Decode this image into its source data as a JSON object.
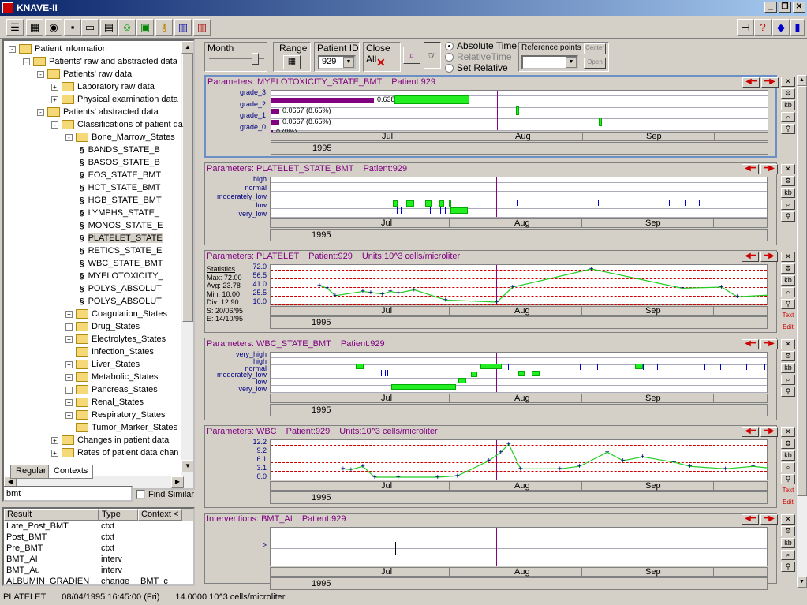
{
  "app": {
    "title": "KNAVE-II"
  },
  "toolbar_icons": [
    "tree-icon",
    "table-icon",
    "camera-icon",
    "save-icon",
    "open-folder-icon",
    "print-icon",
    "run-icon",
    "monitor-icon",
    "key-icon",
    "bar-chart-icon",
    "books-icon"
  ],
  "tree": {
    "items": [
      {
        "label": "Patient information",
        "level": 0,
        "exp": "-",
        "folder": true
      },
      {
        "label": "Patients' raw and abstracted data",
        "level": 1,
        "exp": "-",
        "folder": true
      },
      {
        "label": "Patients' raw data",
        "level": 2,
        "exp": "-",
        "folder": true
      },
      {
        "label": "Laboratory raw data",
        "level": 3,
        "exp": "+",
        "folder": true
      },
      {
        "label": "Physical examination data",
        "level": 3,
        "exp": "+",
        "folder": true
      },
      {
        "label": "Patients' abstracted data",
        "level": 2,
        "exp": "-",
        "folder": true
      },
      {
        "label": "Classifications of patient da",
        "level": 3,
        "exp": "-",
        "folder": true
      },
      {
        "label": "Bone_Marrow_States",
        "level": 4,
        "exp": "-",
        "folder": true
      },
      {
        "label": "BANDS_STATE_B",
        "level": 5,
        "leaf": true
      },
      {
        "label": "BASOS_STATE_B",
        "level": 5,
        "leaf": true
      },
      {
        "label": "EOS_STATE_BMT",
        "level": 5,
        "leaf": true
      },
      {
        "label": "HCT_STATE_BMT",
        "level": 5,
        "leaf": true
      },
      {
        "label": "HGB_STATE_BMT",
        "level": 5,
        "leaf": true
      },
      {
        "label": "LYMPHS_STATE_",
        "level": 5,
        "leaf": true
      },
      {
        "label": "MONOS_STATE_E",
        "level": 5,
        "leaf": true
      },
      {
        "label": "PLATELET_STATE",
        "level": 5,
        "leaf": true,
        "selected": true
      },
      {
        "label": "RETICS_STATE_E",
        "level": 5,
        "leaf": true
      },
      {
        "label": "WBC_STATE_BMT",
        "level": 5,
        "leaf": true
      },
      {
        "label": "MYELOTOXICITY_",
        "level": 5,
        "leaf": true
      },
      {
        "label": "POLYS_ABSOLUT",
        "level": 5,
        "leaf": true
      },
      {
        "label": "POLYS_ABSOLUT",
        "level": 5,
        "leaf": true
      },
      {
        "label": "Coagulation_States",
        "level": 4,
        "exp": "+",
        "folder": true
      },
      {
        "label": "Drug_States",
        "level": 4,
        "exp": "+",
        "folder": true
      },
      {
        "label": "Electrolytes_States",
        "level": 4,
        "exp": "+",
        "folder": true
      },
      {
        "label": "Infection_States",
        "level": 4,
        "folder": true
      },
      {
        "label": "Liver_States",
        "level": 4,
        "exp": "+",
        "folder": true
      },
      {
        "label": "Metabolic_States",
        "level": 4,
        "exp": "+",
        "folder": true
      },
      {
        "label": "Pancreas_States",
        "level": 4,
        "exp": "+",
        "folder": true
      },
      {
        "label": "Renal_States",
        "level": 4,
        "exp": "+",
        "folder": true
      },
      {
        "label": "Respiratory_States",
        "level": 4,
        "exp": "+",
        "folder": true
      },
      {
        "label": "Tumor_Marker_States",
        "level": 4,
        "folder": true
      },
      {
        "label": "Changes in patient data",
        "level": 3,
        "exp": "+",
        "folder": true
      },
      {
        "label": "Rates of patient data chan",
        "level": 3,
        "exp": "+",
        "folder": true
      }
    ]
  },
  "tabs": {
    "regular": "Regular",
    "contexts": "Contexts"
  },
  "search": {
    "value": "bmt",
    "find_similar": "Find Similar"
  },
  "results": {
    "headers": [
      "Result",
      "Type",
      "Context <"
    ],
    "rows": [
      [
        "Late_Post_BMT",
        "ctxt",
        ""
      ],
      [
        "Post_BMT",
        "ctxt",
        ""
      ],
      [
        "Pre_BMT",
        "ctxt",
        ""
      ],
      [
        "BMT_AI",
        "interv",
        ""
      ],
      [
        "BMT_Au",
        "interv",
        ""
      ],
      [
        "ALBUMIN_GRADIEN",
        "change",
        "BMT_c"
      ]
    ]
  },
  "status": {
    "param": "PLATELET",
    "datetime": "08/04/1995 16:45:00 (Fri)",
    "value": "14.0000 10^3 cells/microliter"
  },
  "controls": {
    "month": "Month",
    "range": "Range",
    "patient_id_label": "Patient ID",
    "patient_id": "929",
    "close_all": "Close All",
    "absolute": "Absolute Time",
    "relative": "RelativeTime",
    "set_relative": "Set Relative",
    "ref_points": "Reference points",
    "center": "Center",
    "open": "Open"
  },
  "panels": [
    {
      "title": "Parameters: MYELOTOXICITY_STATE_BMT",
      "patient": "Patient:929",
      "units": "",
      "ylabels": [
        "grade_3",
        "grade_2",
        "grade_1",
        "grade_0"
      ],
      "dist": [
        "0.638 (82.7%)",
        "0.0667 (8.65%)",
        "0.0667 (8.65%)",
        "0 (0%)"
      ],
      "months": [
        "Jul",
        "Aug",
        "Sep"
      ],
      "year": "1995"
    },
    {
      "title": "Parameters: PLATELET_STATE_BMT",
      "patient": "Patient:929",
      "units": "",
      "ylabels": [
        "high",
        "normal",
        "moderately_low",
        "low",
        "very_low"
      ],
      "months": [
        "Jul",
        "Aug",
        "Sep"
      ],
      "year": "1995"
    },
    {
      "title": "Parameters: PLATELET",
      "patient": "Patient:929",
      "units": "Units:10^3 cells/microliter",
      "ylabels": [
        "72.0",
        "56.5",
        "41.0",
        "25.5",
        "10.0"
      ],
      "months": [
        "Jul",
        "Aug",
        "Sep"
      ],
      "year": "1995",
      "stats": [
        "Statistics",
        "Max: 72.00",
        "Avg: 23.78",
        "Min: 10.00",
        "Div: 12.90",
        "S: 20/06/95",
        "E: 14/10/95"
      ]
    },
    {
      "title": "Parameters: WBC_STATE_BMT",
      "patient": "Patient:929",
      "units": "",
      "ylabels": [
        "very_high",
        "high",
        "normal",
        "moderately_low",
        "low",
        "very_low"
      ],
      "months": [
        "Jul",
        "Aug",
        "Sep"
      ],
      "year": "1995"
    },
    {
      "title": "Parameters: WBC",
      "patient": "Patient:929",
      "units": "Units:10^3 cells/microliter",
      "ylabels": [
        "12.2",
        "9.2",
        "6.1",
        "3.1",
        "0.0"
      ],
      "months": [
        "Jul",
        "Aug",
        "Sep"
      ],
      "year": "1995"
    },
    {
      "title": "Interventions: BMT_AI",
      "patient": "Patient:929",
      "units": "",
      "ylabels": [
        ">"
      ],
      "months": [
        "Jul",
        "Aug",
        "Sep"
      ],
      "year": "1995"
    }
  ],
  "side_text": {
    "text": "Text",
    "edit": "Edit"
  },
  "chart_data": [
    {
      "type": "scatter",
      "title": "PLATELET",
      "series": [
        {
          "name": "PLATELET",
          "x": [
            "Jun 20",
            "Jun 22",
            "Jun 24",
            "Jul 01",
            "Jul 03",
            "Jul 06",
            "Jul 08",
            "Jul 10",
            "Jul 14",
            "Jul 22",
            "Aug 04",
            "Aug 08",
            "Aug 28",
            "Sep 20",
            "Sep 30",
            "Oct 04",
            "Oct 14"
          ],
          "values": [
            41,
            36,
            22,
            30,
            28,
            25,
            30,
            27,
            33,
            14,
            10,
            38,
            72,
            36,
            38,
            20,
            24
          ]
        }
      ],
      "ylim": [
        10,
        72
      ]
    },
    {
      "type": "line",
      "title": "WBC",
      "series": [
        {
          "name": "WBC",
          "x": [
            "Jun 26",
            "Jun 28",
            "Jul 01",
            "Jul 04",
            "Jul 10",
            "Jul 20",
            "Jul 25",
            "Aug 02",
            "Aug 05",
            "Aug 07",
            "Aug 10",
            "Aug 20",
            "Aug 25",
            "Sep 01",
            "Sep 05",
            "Sep 10",
            "Sep 18",
            "Sep 22",
            "Oct 01",
            "Oct 08",
            "Oct 14"
          ],
          "values": [
            3.1,
            2.8,
            4.0,
            0.0,
            0.0,
            0.0,
            0.5,
            6.1,
            9.2,
            12.2,
            3.1,
            3.1,
            4.0,
            9.2,
            6.1,
            7.5,
            5.5,
            4.0,
            3.1,
            4.0,
            3.1
          ]
        }
      ],
      "ylim": [
        0,
        12.2
      ]
    }
  ]
}
